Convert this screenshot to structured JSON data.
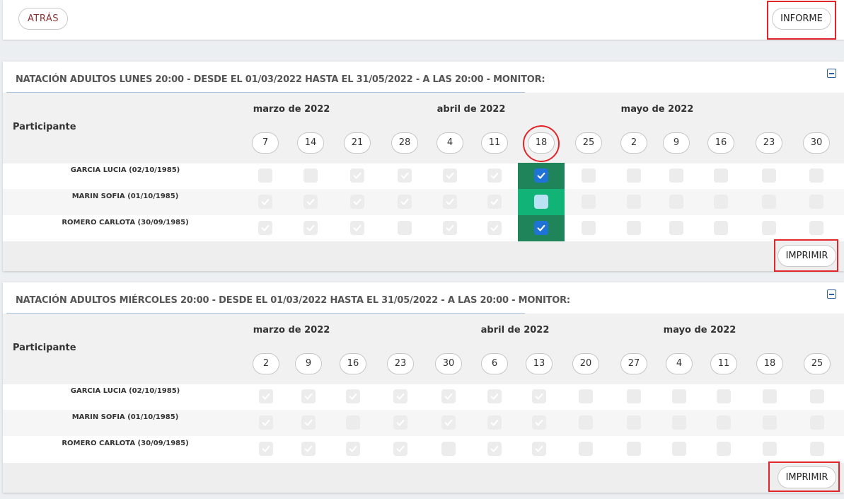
{
  "topbar": {
    "back_label": "ATRÁS",
    "report_label": "INFORME"
  },
  "participants_header": "Participante",
  "sessions": [
    {
      "title": "NATACIÓN ADULTOS LUNES 20:00 - DESDE EL 01/03/2022 HASTA EL 31/05/2022 - A LAS 20:00 - MONITOR:",
      "months": [
        "marzo de 2022",
        "abril de 2022",
        "mayo de 2022"
      ],
      "dates": [
        "7",
        "14",
        "21",
        "28",
        "4",
        "11",
        "18",
        "25",
        "2",
        "9",
        "16",
        "23",
        "30"
      ],
      "highlighted_date": "18",
      "participants": [
        {
          "name": "GARCIA LUCIA (02/10/1985)",
          "attendance": [
            "empty",
            "empty",
            "gray",
            "gray",
            "gray",
            "gray",
            "checked",
            "empty",
            "empty",
            "empty",
            "empty",
            "empty",
            "empty"
          ]
        },
        {
          "name": "MARIN SOFIA (01/10/1985)",
          "attendance": [
            "gray",
            "gray",
            "gray",
            "gray",
            "gray",
            "gray",
            "light",
            "empty",
            "empty",
            "empty",
            "empty",
            "empty",
            "empty"
          ]
        },
        {
          "name": "ROMERO CARLOTA (30/09/1985)",
          "attendance": [
            "gray",
            "gray",
            "gray",
            "empty",
            "gray",
            "gray",
            "checked",
            "empty",
            "empty",
            "empty",
            "empty",
            "empty",
            "empty"
          ]
        }
      ],
      "print_label": "IMPRIMIR"
    },
    {
      "title": "NATACIÓN ADULTOS MIÉRCOLES 20:00 - DESDE EL 01/03/2022 HASTA EL 31/05/2022 - A LAS 20:00 - MONITOR:",
      "months": [
        "marzo de 2022",
        "abril de 2022",
        "mayo de 2022"
      ],
      "dates": [
        "2",
        "9",
        "16",
        "23",
        "30",
        "6",
        "13",
        "20",
        "27",
        "4",
        "11",
        "18",
        "25"
      ],
      "highlighted_date": "",
      "participants": [
        {
          "name": "GARCIA LUCIA (02/10/1985)",
          "attendance": [
            "gray",
            "gray",
            "gray",
            "gray",
            "gray",
            "gray",
            "gray",
            "empty",
            "empty",
            "empty",
            "empty",
            "empty",
            "empty"
          ]
        },
        {
          "name": "MARIN SOFIA (01/10/1985)",
          "attendance": [
            "gray",
            "gray",
            "empty",
            "gray",
            "gray",
            "gray",
            "gray",
            "empty",
            "empty",
            "empty",
            "empty",
            "empty",
            "empty"
          ]
        },
        {
          "name": "ROMERO CARLOTA (30/09/1985)",
          "attendance": [
            "gray",
            "gray",
            "gray",
            "gray",
            "empty",
            "gray",
            "gray",
            "empty",
            "empty",
            "empty",
            "empty",
            "empty",
            "empty"
          ]
        }
      ],
      "print_label": "IMPRIMIR"
    }
  ],
  "colors": {
    "accent_blue": "#1f73d6",
    "highlight_dark_green": "#20845a",
    "highlight_bright_green": "#12b377",
    "annotation_red": "#e0262b",
    "back_text": "#8a3434"
  },
  "icons": [
    "check-icon",
    "minus-square-icon"
  ]
}
